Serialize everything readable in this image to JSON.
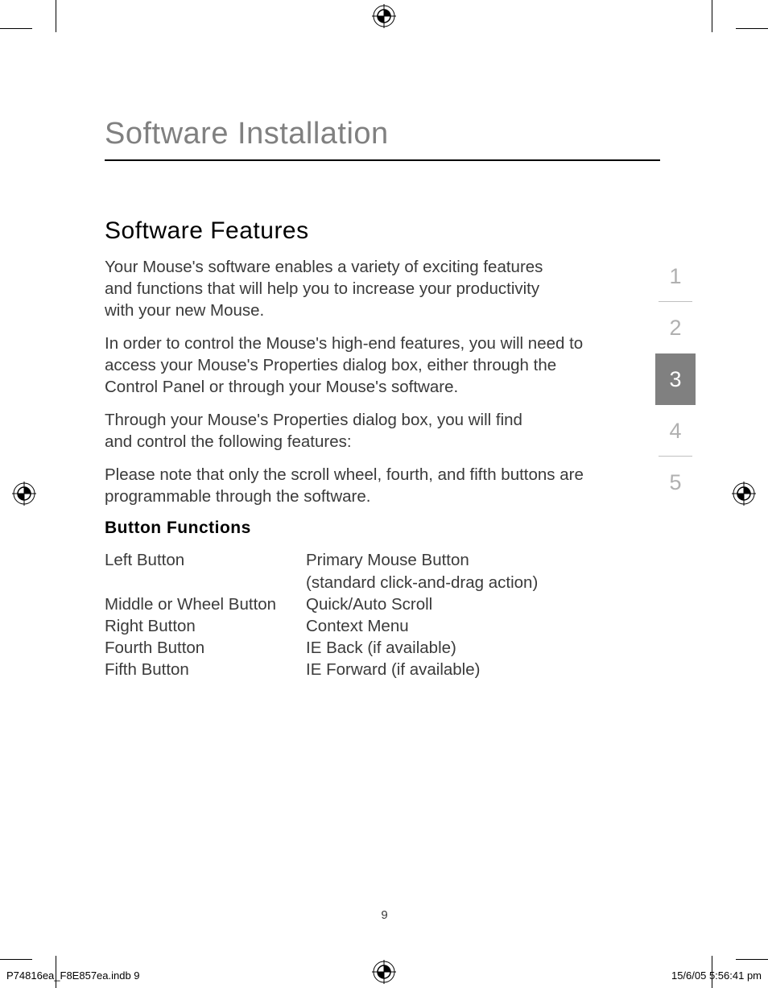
{
  "chapter_title": "Software Installation",
  "section_title": "Software Features",
  "paragraphs": [
    "Your Mouse's software enables a variety of exciting features and functions that will help you to increase your productivity with your new Mouse.",
    "In order to control the Mouse's high-end features, you will need to access your Mouse's Properties dialog box, either through the Control Panel or through your Mouse's software.",
    "Through your Mouse's Properties dialog box, you will find and control the following features:",
    "Please note that only the scroll wheel, fourth, and fifth buttons are programmable through the software."
  ],
  "sub_heading": "Button Functions",
  "button_rows": [
    {
      "label": "Left Button",
      "desc_lines": [
        "Primary Mouse Button",
        "(standard click-and-drag action)"
      ]
    },
    {
      "label": "Middle or Wheel Button",
      "desc_lines": [
        "Quick/Auto Scroll"
      ]
    },
    {
      "label": "Right Button",
      "desc_lines": [
        "Context Menu"
      ]
    },
    {
      "label": "Fourth Button",
      "desc_lines": [
        "IE Back (if available)"
      ]
    },
    {
      "label": "Fifth Button",
      "desc_lines": [
        "IE Forward (if available)"
      ]
    }
  ],
  "tabs": [
    "1",
    "2",
    "3",
    "4",
    "5"
  ],
  "active_tab_index": 2,
  "page_number": "9",
  "footer_left": "P74816ea_F8E857ea.indb   9",
  "footer_right": "15/6/05   5:56:41 pm"
}
